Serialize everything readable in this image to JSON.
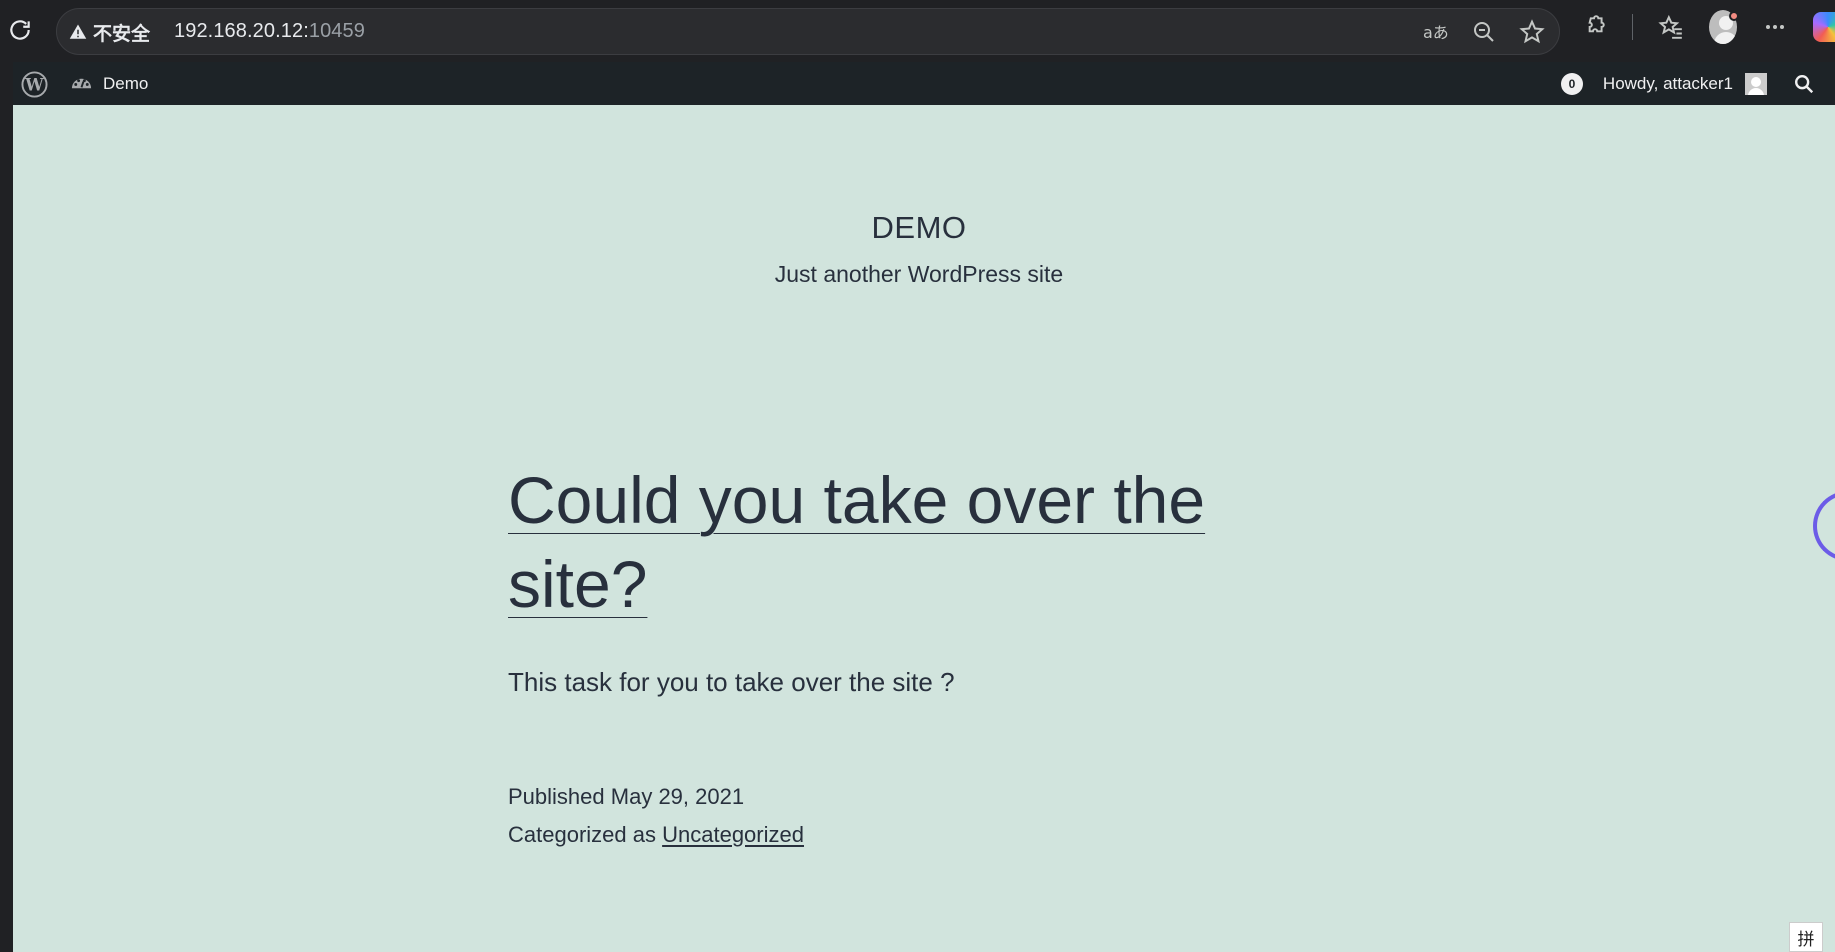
{
  "browser": {
    "security_label": "不安全",
    "url_host": "192.168.20.12:",
    "url_port": "10459"
  },
  "adminbar": {
    "site_name": "Demo",
    "comment_count": "0",
    "howdy": "Howdy, attacker1"
  },
  "site": {
    "title": "DEMO",
    "description": "Just another WordPress site"
  },
  "post": {
    "title": "Could you take over the site?",
    "content": "This task for you to take over the site ?",
    "published_label": "Published",
    "published_date": "May 29, 2021",
    "categorized_label": "Categorized as",
    "category": "Uncategorized"
  },
  "ime": {
    "label": "拼"
  }
}
